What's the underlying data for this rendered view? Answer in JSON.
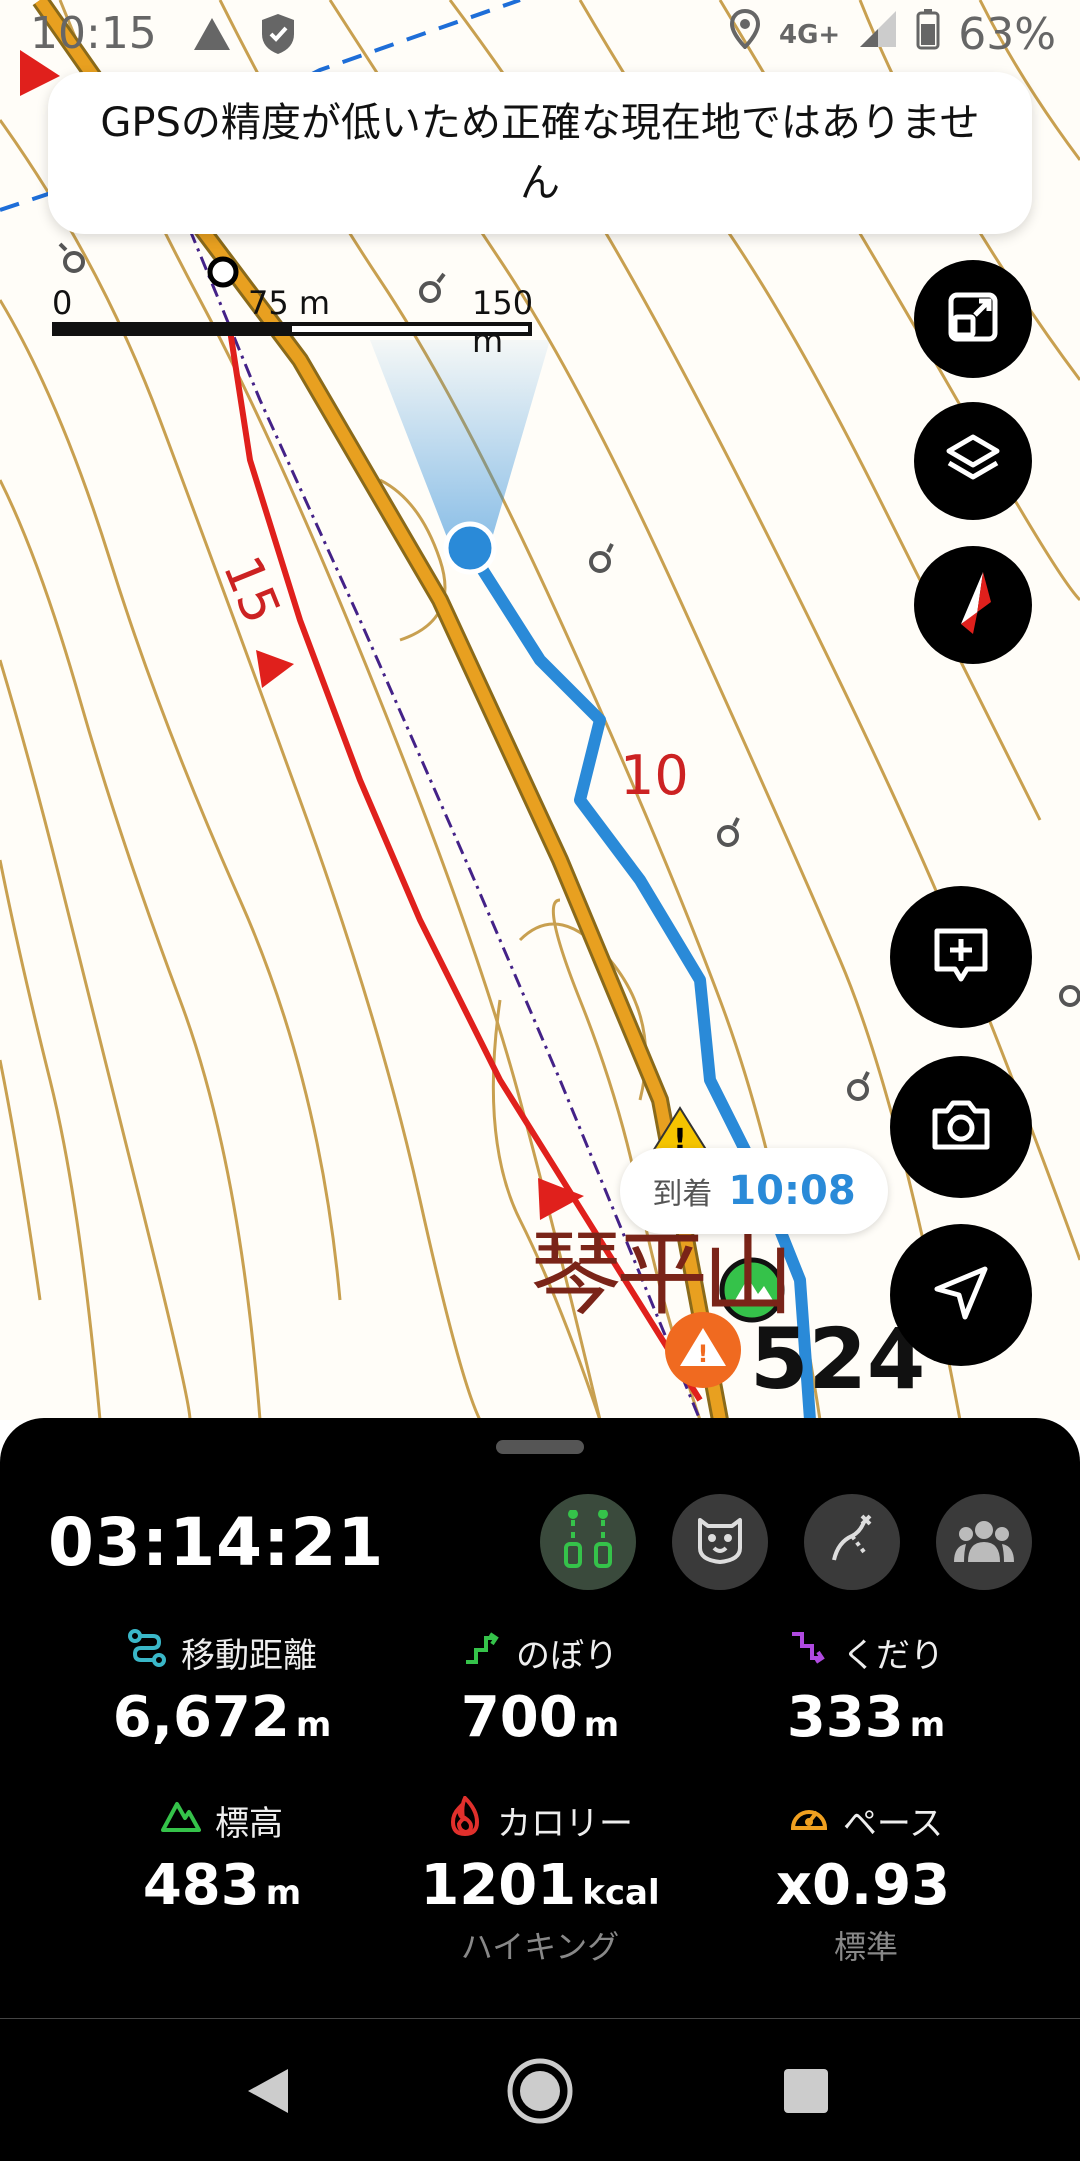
{
  "status_bar": {
    "time": "10:15",
    "network": "4G+",
    "battery": "63%"
  },
  "toast": {
    "message": "GPSの精度が低いため正確な現在地ではありません"
  },
  "scale_bar": {
    "labels": [
      "0",
      "75 m",
      "150 m"
    ]
  },
  "map": {
    "contour_labels": [
      "15",
      "10"
    ],
    "mountain_name": "琴平山",
    "elevation_label": "524"
  },
  "arrival": {
    "label": "到着",
    "time": "10:08"
  },
  "panel": {
    "elapsed_time": "03:14:21",
    "stats": [
      {
        "label": "移動距離",
        "value": "6,672",
        "unit": "m",
        "sub": ""
      },
      {
        "label": "のぼり",
        "value": "700",
        "unit": "m",
        "sub": ""
      },
      {
        "label": "くだり",
        "value": "333",
        "unit": "m",
        "sub": ""
      },
      {
        "label": "標高",
        "value": "483",
        "unit": "m",
        "sub": ""
      },
      {
        "label": "カロリー",
        "value": "1201",
        "unit": "kcal",
        "sub": "ハイキング"
      },
      {
        "label": "ペース",
        "value": "x0.93",
        "unit": "",
        "sub": "標準"
      }
    ]
  },
  "colors": {
    "accent_blue": "#2a8ad8",
    "route_red": "#e0201c",
    "road_orange": "#e8a020",
    "contour": "#c8a050",
    "panel_bg": "#000000",
    "active_green": "#35c24a"
  }
}
